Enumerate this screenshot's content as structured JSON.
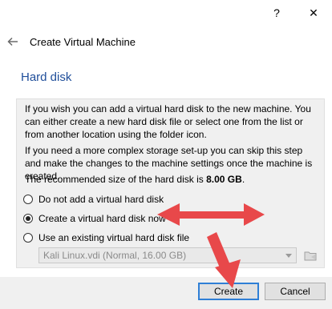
{
  "window": {
    "help_label": "?",
    "close_label": "✕"
  },
  "wizard": {
    "title": "Create Virtual Machine",
    "section_title": "Hard disk"
  },
  "content": {
    "para1": "If you wish you can add a virtual hard disk to the new machine. You can either create a new hard disk file or select one from the list or from another location using the folder icon.",
    "para2": "If you need a more complex storage set-up you can skip this step and make the changes to the machine settings once the machine is created.",
    "recommended_prefix": "The recommended size of the hard disk is ",
    "recommended_size": "8.00 GB",
    "recommended_suffix": "."
  },
  "options": [
    {
      "label": "Do not add a virtual hard disk",
      "checked": false
    },
    {
      "label": "Create a virtual hard disk now",
      "checked": true
    },
    {
      "label": "Use an existing virtual hard disk file",
      "checked": false
    }
  ],
  "existing_disk": {
    "selected": "Kali Linux.vdi (Normal, 16.00 GB)",
    "enabled": false
  },
  "footer": {
    "create_label": "Create",
    "cancel_label": "Cancel"
  },
  "annotation_color": "#e8484a",
  "accent_color": "#2f7fd6"
}
